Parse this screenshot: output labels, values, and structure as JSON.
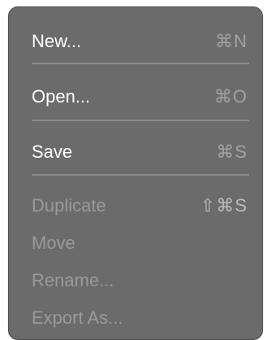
{
  "menu": {
    "items": [
      {
        "label": "New...",
        "shortcut": "⌘N",
        "enabled": true
      },
      {
        "label": "Open...",
        "shortcut": "⌘O",
        "enabled": true
      },
      {
        "label": "Save",
        "shortcut": "⌘S",
        "enabled": true
      },
      {
        "label": "Duplicate",
        "shortcut": "⇧⌘S",
        "enabled": false
      },
      {
        "label": "Move",
        "shortcut": "",
        "enabled": false
      },
      {
        "label": "Rename...",
        "shortcut": "",
        "enabled": false
      },
      {
        "label": "Export As...",
        "shortcut": "",
        "enabled": false
      }
    ]
  },
  "colors": {
    "menu_background": "#6b6b6b",
    "enabled_text": "#ffffff",
    "disabled_text": "#9a9a9a",
    "separator": "#8a8a8a"
  }
}
